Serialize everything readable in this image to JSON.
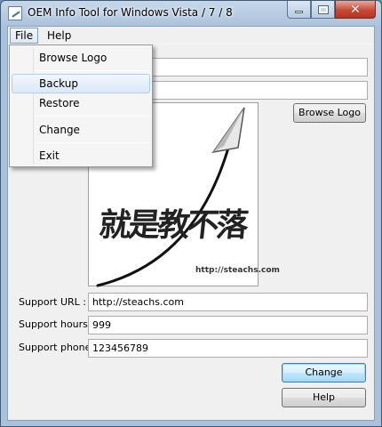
{
  "window": {
    "title": "OEM Info Tool for Windows Vista / 7 / 8"
  },
  "menubar": {
    "file": "File",
    "help": "Help"
  },
  "file_menu": {
    "items": [
      {
        "label": "Browse Logo"
      },
      {
        "label": "Backup"
      },
      {
        "label": "Restore"
      },
      {
        "label": "Change"
      },
      {
        "label": "Exit"
      }
    ],
    "highlighted": "Backup"
  },
  "form": {
    "manufacturer_value": "",
    "model_value": "",
    "support_url_label": "Support URL :",
    "support_url_value": "http://steachs.com",
    "support_hours_label": "Support hours :",
    "support_hours_value": "999",
    "support_phone_label": "Support phone :",
    "support_phone_value": "123456789"
  },
  "logo": {
    "text": "就是教不落",
    "url": "http://steachs.com"
  },
  "buttons": {
    "browse_logo": "Browse Logo",
    "change": "Change",
    "help": "Help"
  },
  "colors": {
    "title_glass": "#a9c1da",
    "close_button": "#c74a36",
    "focus_border": "#3c7fb1"
  }
}
